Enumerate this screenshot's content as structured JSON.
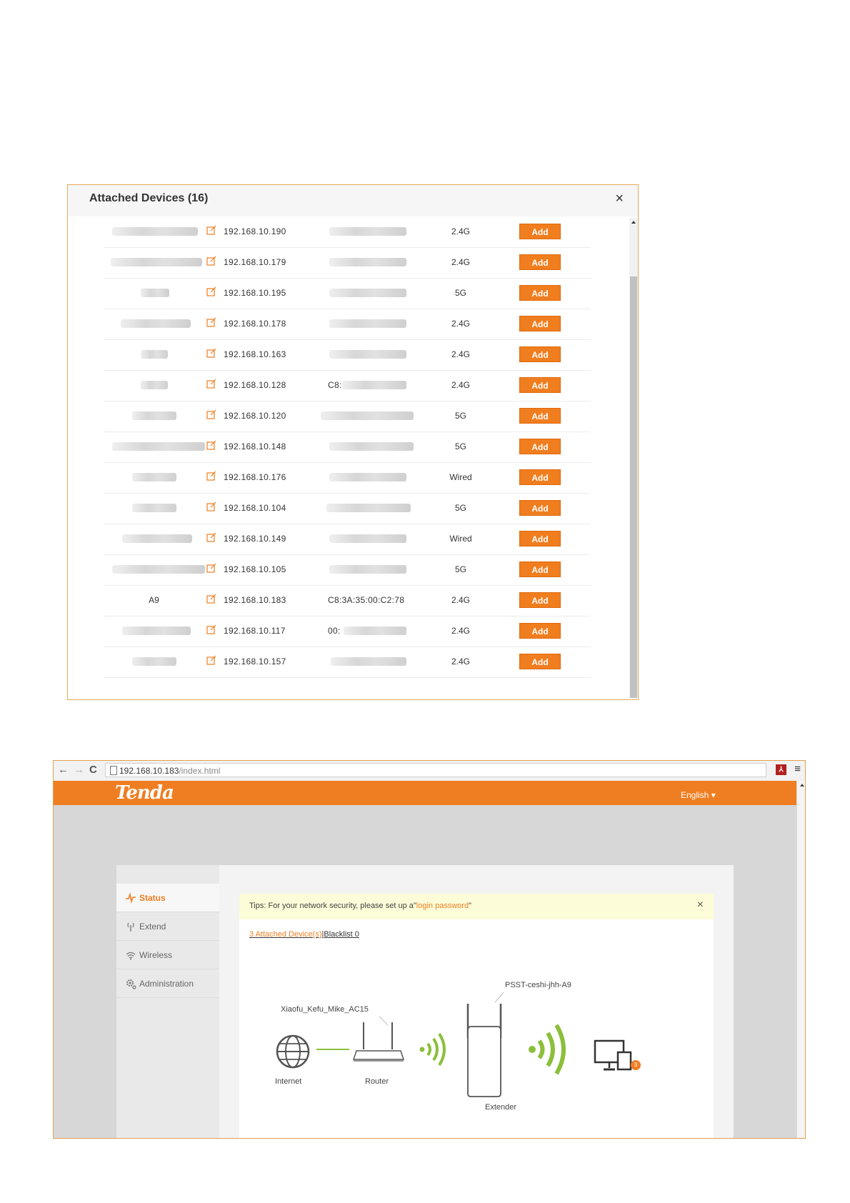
{
  "dialog": {
    "title": "Attached Devices (16)",
    "close": "×",
    "devices": [
      {
        "name": "",
        "ip": "192.168.10.190",
        "mac": "",
        "band": "2.4G",
        "action": "Add"
      },
      {
        "name": "",
        "ip": "192.168.10.179",
        "mac": "",
        "band": "2.4G",
        "action": "Add"
      },
      {
        "name": "",
        "ip": "192.168.10.195",
        "mac": "",
        "band": "5G",
        "action": "Add"
      },
      {
        "name": "",
        "ip": "192.168.10.178",
        "mac": "",
        "band": "2.4G",
        "action": "Add"
      },
      {
        "name": "",
        "ip": "192.168.10.163",
        "mac": "",
        "band": "2.4G",
        "action": "Add"
      },
      {
        "name": "",
        "ip": "192.168.10.128",
        "mac": "C8:",
        "band": "2.4G",
        "action": "Add"
      },
      {
        "name": "",
        "ip": "192.168.10.120",
        "mac": "",
        "band": "5G",
        "action": "Add"
      },
      {
        "name": "",
        "ip": "192.168.10.148",
        "mac": "",
        "band": "5G",
        "action": "Add"
      },
      {
        "name": "",
        "ip": "192.168.10.176",
        "mac": "",
        "band": "Wired",
        "action": "Add"
      },
      {
        "name": "",
        "ip": "192.168.10.104",
        "mac": "",
        "band": "5G",
        "action": "Add"
      },
      {
        "name": "",
        "ip": "192.168.10.149",
        "mac": "",
        "band": "Wired",
        "action": "Add"
      },
      {
        "name": "",
        "ip": "192.168.10.105",
        "mac": "",
        "band": "5G",
        "action": "Add"
      },
      {
        "name": "A9",
        "ip": "192.168.10.183",
        "mac": "C8:3A:35:00:C2:78",
        "band": "2.4G",
        "action": "Add",
        "highlighted": true
      },
      {
        "name": "",
        "ip": "192.168.10.117",
        "mac": "00:",
        "band": "2.4G",
        "action": "Add"
      },
      {
        "name": "",
        "ip": "192.168.10.157",
        "mac": "",
        "band": "2.4G",
        "action": "Add"
      }
    ]
  },
  "browser": {
    "back": "←",
    "forward": "→",
    "reload": "C",
    "url_host": "192.168.10.183",
    "url_path": "/index.html",
    "menu": "≡",
    "logo": "Tenda",
    "language": "English ▾",
    "sidebar": [
      {
        "label": "Status",
        "icon": "status-pulse-icon",
        "active": true
      },
      {
        "label": "Extend",
        "icon": "antenna-icon"
      },
      {
        "label": "Wireless",
        "icon": "wifi-icon"
      },
      {
        "label": "Administration",
        "icon": "gear-icon"
      }
    ],
    "tip": {
      "prefix": "Tips: For your network security, please set up a\"",
      "link": "login password",
      "suffix": "\""
    },
    "tip_close": "×",
    "attached_link": "3 Attached Device(s)",
    "blacklist_link": "Blacklist 0",
    "topology": {
      "router_ssid": "Xiaofu_Kefu_Mike_AC15",
      "extender_ssid": "PSST-ceshi-jhh-A9",
      "internet_label": "Internet",
      "router_label": "Router",
      "extender_label": "Extender",
      "client_count": "3"
    },
    "colors": {
      "brand": "#ef7e22",
      "signal": "#8bbf3a"
    }
  }
}
